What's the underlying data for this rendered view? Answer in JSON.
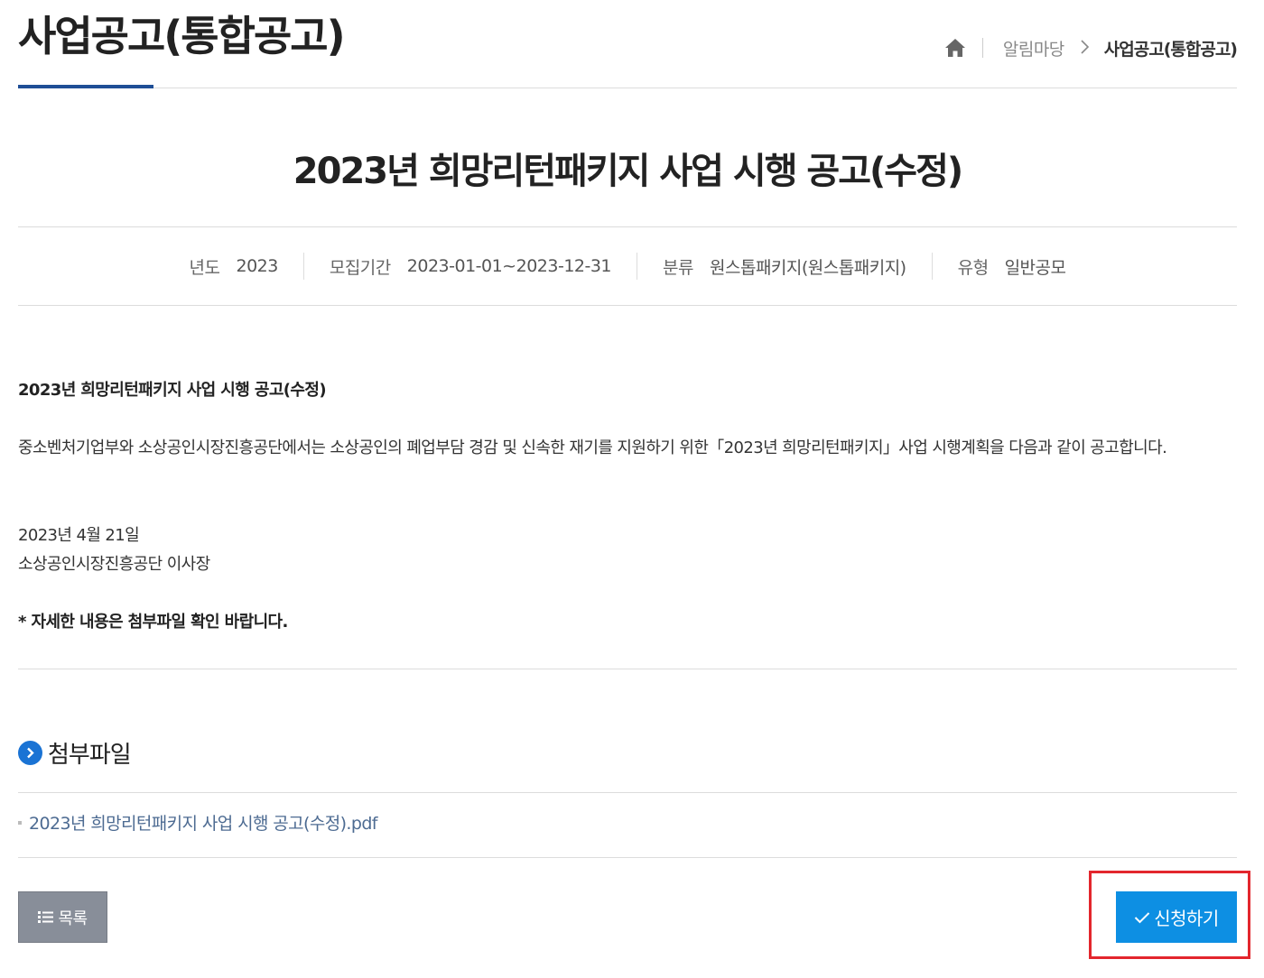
{
  "header": {
    "page_title": "사업공고(통합공고)",
    "breadcrumb": {
      "home_icon": "home-icon",
      "parent": "알림마당",
      "current": "사업공고(통합공고)"
    }
  },
  "post": {
    "title": "2023년 희망리턴패키지 사업 시행 공고(수정)",
    "meta": {
      "year_label": "년도",
      "year_value": "2023",
      "period_label": "모집기간",
      "period_value": "2023-01-01~2023-12-31",
      "category_label": "분류",
      "category_value": "원스톱패키지(원스톱패키지)",
      "type_label": "유형",
      "type_value": "일반공모"
    },
    "body": {
      "heading": "2023년 희망리턴패키지 사업 시행 공고(수정)",
      "intro": "중소벤처기업부와 소상공인시장진흥공단에서는 소상공인의 폐업부담 경감 및 신속한 재기를 지원하기 위한「2023년 희망리턴패키지」사업 시행계획을 다음과 같이 공고합니다.",
      "date": "2023년 4월 21일",
      "signer": "소상공인시장진흥공단 이사장",
      "notice": "* 자세한 내용은 첨부파일 확인 바랍니다."
    }
  },
  "attachments": {
    "heading": "첨부파일",
    "files": [
      "2023년 희망리턴패키지 사업 시행 공고(수정).pdf"
    ]
  },
  "actions": {
    "list_label": "목록",
    "apply_label": "신청하기"
  },
  "colors": {
    "accent_blue": "#1f4e96",
    "apply_button": "#0d8fe3",
    "list_button": "#888e99",
    "highlight_box": "#e3262d",
    "link_text": "#4d6b92"
  }
}
